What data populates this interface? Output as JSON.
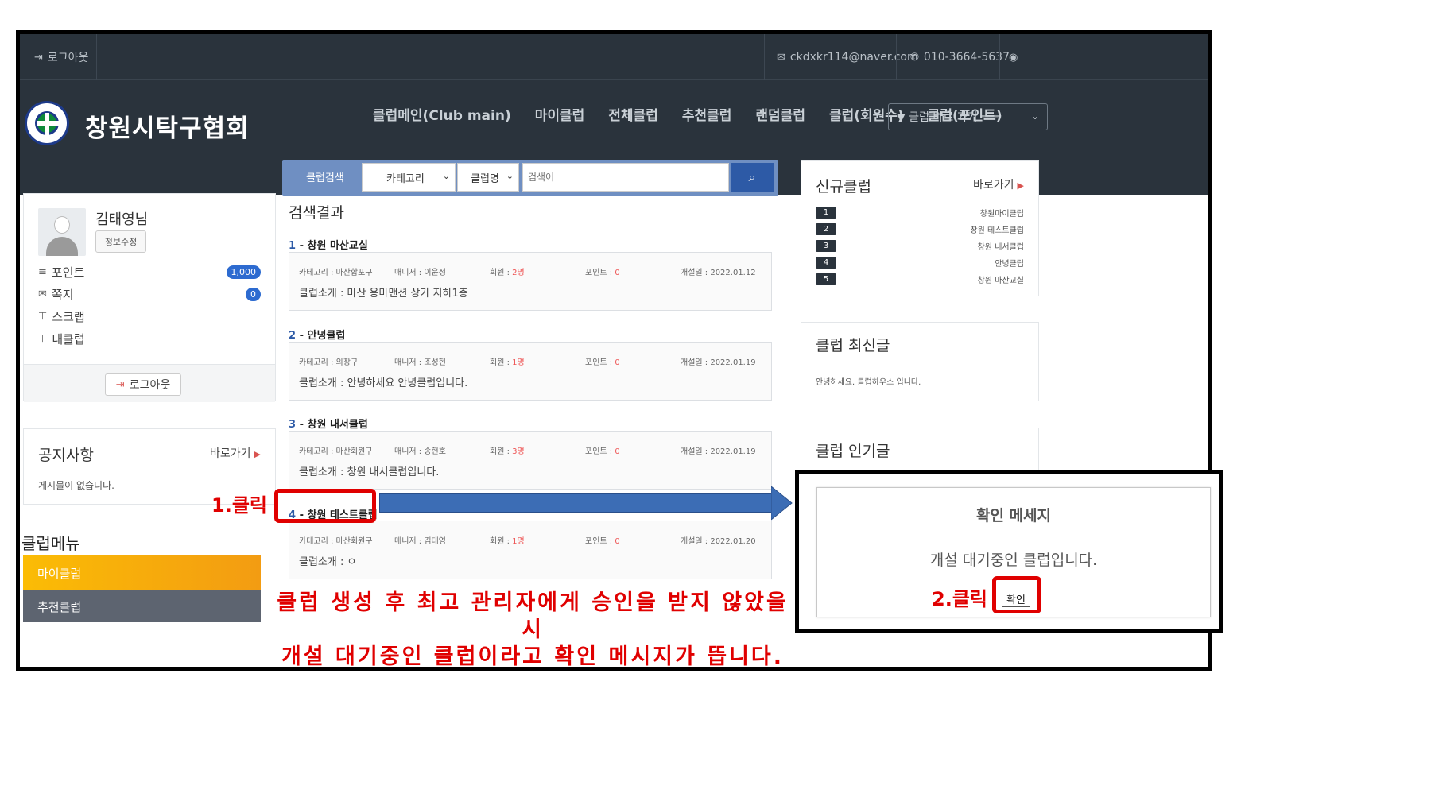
{
  "topbar": {
    "logout": "로그아웃",
    "email": "ckdxkr114@naver.com",
    "phone": "010-3664-5637"
  },
  "header": {
    "site_title": "창원시탁구협회",
    "nav": [
      "클럽메인(Club main)",
      "마이클럽",
      "전체클럽",
      "추천클럽",
      "랜덤클럽",
      "클럽(회원수)",
      "클럽(포인트)"
    ],
    "quick_select": "▼ 클럽 바로 가기 ═══"
  },
  "profile": {
    "name": "김태영님",
    "edit": "정보수정",
    "rows": [
      {
        "label": "포인트",
        "badge": "1,000"
      },
      {
        "label": "쪽지",
        "badge": "0"
      },
      {
        "label": "스크랩",
        "badge": ""
      },
      {
        "label": "내클럽",
        "badge": ""
      }
    ],
    "logout": "로그아웃"
  },
  "notice": {
    "title": "공지사항",
    "goto": "바로가기",
    "text": "게시물이 없습니다."
  },
  "club_menu": {
    "title": "클럽메뉴",
    "items": [
      "마이클럽",
      "추천클럽"
    ]
  },
  "search": {
    "label": "클럽검색",
    "category": "카테고리",
    "field": "클럽명",
    "placeholder": "검색어"
  },
  "results_title": "검색결과",
  "results": [
    {
      "num": "1",
      "name": "창원 마산교실",
      "category": "카테고리 : 마산합포구",
      "manager": "매니저 : 이윤정",
      "members_label": "회원 : ",
      "members": "2명",
      "points_label": "포인트 : ",
      "points": "0",
      "opened": "개설일 : 2022.01.12",
      "intro": "클럽소개 : 마산 용마맨션 상가 지하1층"
    },
    {
      "num": "2",
      "name": "안녕클럽",
      "category": "카테고리 : 의창구",
      "manager": "매니저 : 조성현",
      "members_label": "회원 : ",
      "members": "1명",
      "points_label": "포인트 : ",
      "points": "0",
      "opened": "개설일 : 2022.01.19",
      "intro": "클럽소개 : 안녕하세요 안녕클럽입니다."
    },
    {
      "num": "3",
      "name": "창원 내서클럽",
      "category": "카테고리 : 마산회원구",
      "manager": "매니저 : 송현호",
      "members_label": "회원 : ",
      "members": "3명",
      "points_label": "포인트 : ",
      "points": "0",
      "opened": "개설일 : 2022.01.19",
      "intro": "클럽소개 : 창원 내서클럽입니다."
    },
    {
      "num": "4",
      "name": "창원 테스트클럽",
      "category": "카테고리 : 마산회원구",
      "manager": "매니저 : 김태영",
      "members_label": "회원 : ",
      "members": "1명",
      "points_label": "포인트 : ",
      "points": "0",
      "opened": "개설일 : 2022.01.20",
      "intro": "클럽소개 : ㅇ"
    }
  ],
  "new_clubs": {
    "title": "신규클럽",
    "goto": "바로가기",
    "items": [
      {
        "num": "1",
        "name": "창원마이클럽"
      },
      {
        "num": "2",
        "name": "창원 테스트클럽"
      },
      {
        "num": "3",
        "name": "창원 내서클럽"
      },
      {
        "num": "4",
        "name": "안녕클럽"
      },
      {
        "num": "5",
        "name": "창원 마산교실"
      }
    ]
  },
  "latest": {
    "title": "클럽 최신글",
    "text": "안녕하세요. 클럽하우스 입니다."
  },
  "popular": {
    "title": "클럽 인기글"
  },
  "annotations": {
    "step1": "1.클릭",
    "step2": "2.클릭",
    "caption_line1": "클럽 생성 후 최고 관리자에게 승인을 받지 않았을 시",
    "caption_line2": "개설 대기중인 클럽이라고 확인 메시지가 뜹니다."
  },
  "dialog": {
    "title": "확인 메세지",
    "message": "개설 대기중인 클럽입니다.",
    "ok": "확인"
  },
  "colors": {
    "header_bg": "#2a333c",
    "accent_blue": "#2d5aa6",
    "annotation_red": "#e00000",
    "menu_yellow": "#fbbc05"
  }
}
